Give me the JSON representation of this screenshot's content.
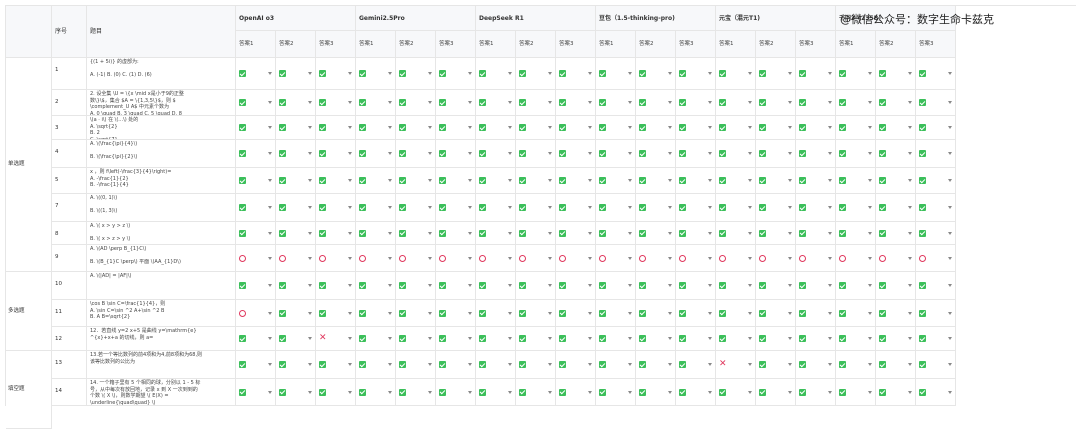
{
  "watermark": "@微信公众号：数字生命卡兹克",
  "headers": {
    "seq": "序号",
    "question": "题目"
  },
  "models": [
    "OpenAI o3",
    "Gemini2.5Pro",
    "DeepSeek R1",
    "豆包（1.5-thinking-pro)",
    "元宝（混元T1)",
    "千问3（235B)"
  ],
  "answer_labels": [
    "答案1",
    "答案2",
    "答案3"
  ],
  "categories": [
    {
      "label": "单选题",
      "start": 0,
      "span": 8
    },
    {
      "label": "多选题",
      "start": 8,
      "span": 3
    },
    {
      "label": "填空题",
      "start": 11,
      "span": 3
    }
  ],
  "rows": [
    {
      "num": "1",
      "q": "{(1 + 5i)} 的虚部为:\n\nA. (-1) B. (0) C. (1) D. (6)",
      "r": "ccccccccccccccccccc"
    },
    {
      "num": "2",
      "q": "2. 设全集 \\U = \\{x \\mid x是小于9的正整\n数\\}\\$，集合 $A = \\{1,3,5\\}$，则 $\n\\complement_U A$ 中元素个数为\nA. 0 \\quad B. 3 \\quad C. 5 \\quad D. 8",
      "r": "cccccccccccccccccc"
    },
    {
      "num": "3",
      "q": "\\(a · i\\) 在 \\(...\\) 处的\nA.  \\sqrt{2}\nB.   2\nC.   \\sqrt{7}",
      "r": "cccccccccccccccccc"
    },
    {
      "num": "4",
      "q": "A. \\(\\frac{\\pi}{4}\\)\n\nB. \\(\\frac{\\pi}{2}\\)",
      "r": "cccccccccccccccccc"
    },
    {
      "num": "5",
      "q": "x ，则 f\\left(-\\frac{3}{4}\\right)=\nA.  -\\frac{1}{2}\nB.  -\\frac{1}{4}",
      "r": "cccccccccccccccccc"
    },
    {
      "num": "7",
      "q": "A. \\((0, 1)\\)\n\nB. \\((1, 3)\\)",
      "r": "cccccccccccccccccc"
    },
    {
      "num": "8",
      "q": "A. \\( x > y > z \\)\n\nB. \\( x > z > y \\)",
      "r": "cccccccccccccccccc"
    },
    {
      "num": "9",
      "q": "A. \\(AD \\perp B_{1}C\\)\n\nB. \\(B_{1}C \\perp\\) 平面 \\(AA_{1}D\\)",
      "r": "oooooooooooooooooo"
    },
    {
      "num": "10",
      "q": "A. \\(|AD| = |AF|\\)",
      "r": "cccccccccccccccccc"
    },
    {
      "num": "11",
      "q": "\\cos B \\sin C=\\frac{1}{4}，则\nA.  \\sin C=\\sin ^2 A+\\sin ^2 B\nB.  A B=\\sqrt{2}",
      "r": "occccccccccccccccc"
    },
    {
      "num": "12",
      "q": "12．若直线 y=2 x+5 是曲线 y=\\mathrm{e}\n^{x}+x+a 的切线，则 a=",
      "r": "ccxccccccccccccccc"
    },
    {
      "num": "13",
      "q": "13.若一个等比数列的前4项和为4,前8项和为68,则\n该等比数列的公比为",
      "r": "ccccccccccccxccccc"
    },
    {
      "num": "14",
      "q": "14. 一个箱子里有 5 个相同的球，分别以 1 - 5 标\n号，从中每次有放回地，记录 x 到 X 一次到到的\n个数 \\( X \\)，则数学期望 \\( E(X) =\n\\underline{\\quad\\quad} \\)",
      "r": "cccccccccccccccccc"
    }
  ]
}
